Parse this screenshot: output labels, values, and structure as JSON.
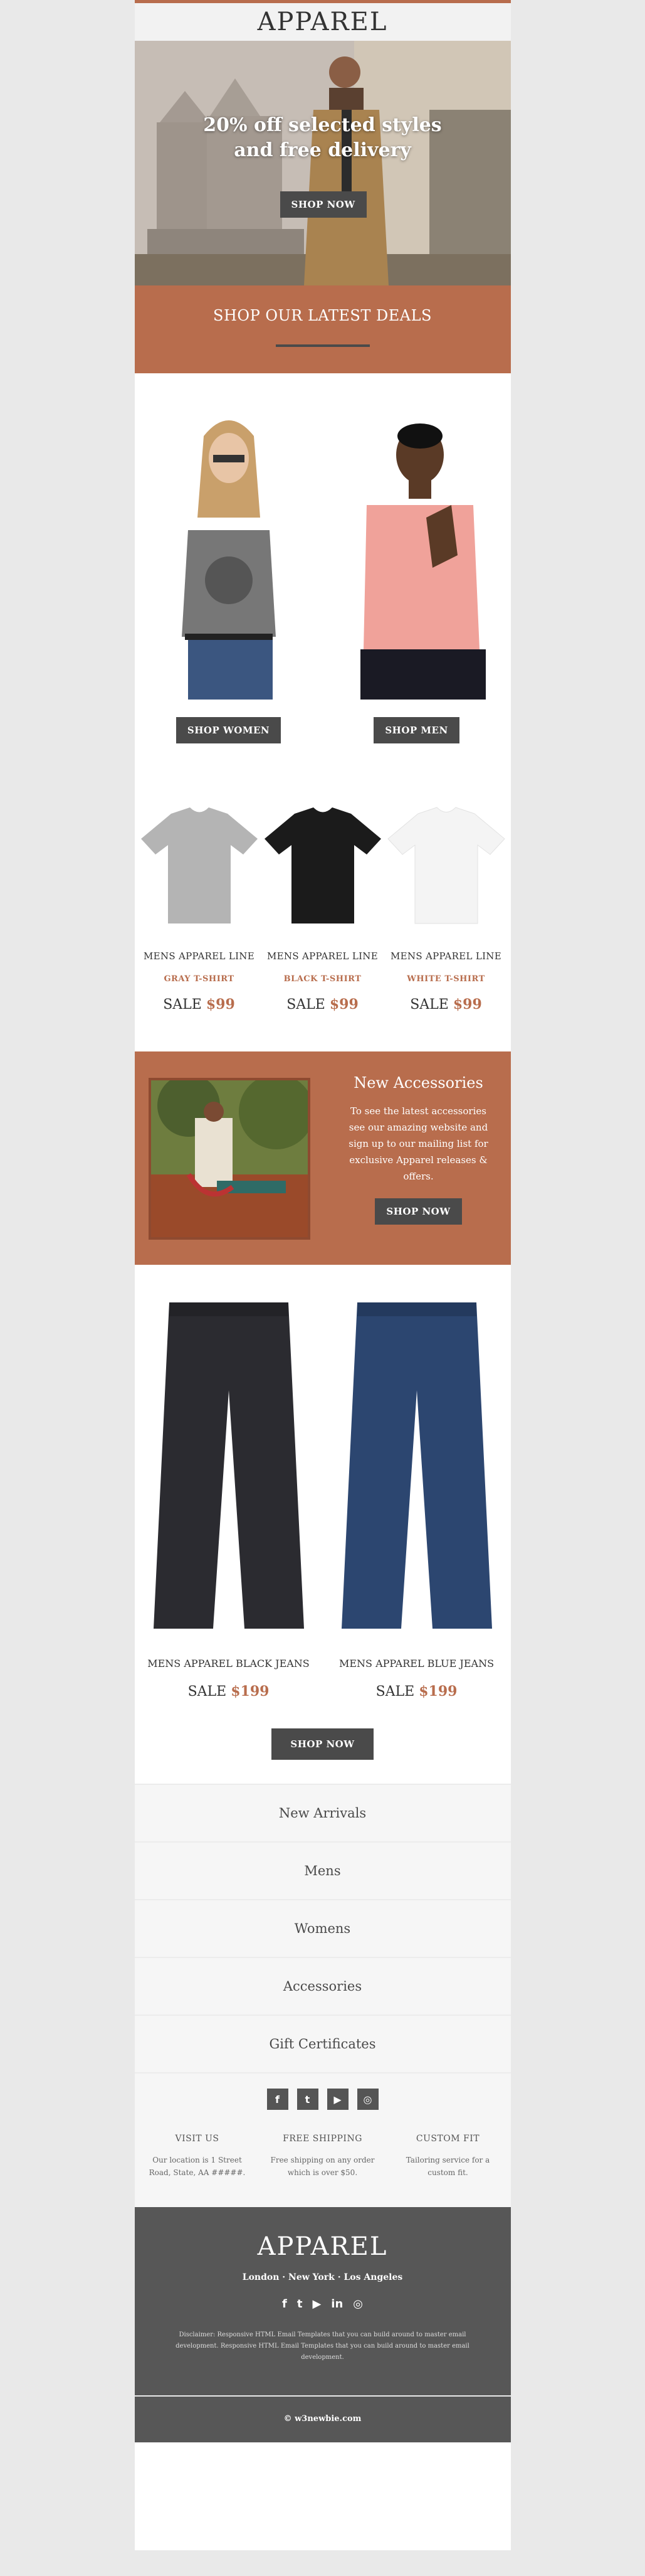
{
  "header": {
    "logo": "APPAREL"
  },
  "hero": {
    "headline_line1": "20% off selected styles",
    "headline_line2": "and free delivery",
    "button": "SHOP NOW"
  },
  "deals": {
    "title": "SHOP OUR LATEST DEALS"
  },
  "featured": [
    {
      "button": "SHOP WOMEN"
    },
    {
      "button": "SHOP MEN"
    }
  ],
  "tees": [
    {
      "name": "MENS APPAREL LINE",
      "color": "GRAY T-SHIRT",
      "sale": "SALE",
      "price": "$99",
      "swatch": "#b4b4b4"
    },
    {
      "name": "MENS APPAREL LINE",
      "color": "BLACK T-SHIRT",
      "sale": "SALE",
      "price": "$99",
      "swatch": "#1b1b1b"
    },
    {
      "name": "MENS APPAREL LINE",
      "color": "WHITE T-SHIRT",
      "sale": "SALE",
      "price": "$99",
      "swatch": "#f4f4f4"
    }
  ],
  "accessories": {
    "title": "New Accessories",
    "description": "To see the latest accessories see our amazing website and sign up to our mailing list for exclusive Apparel releases & offers.",
    "button": "SHOP NOW"
  },
  "jeans": [
    {
      "name": "MENS APPAREL BLACK JEANS",
      "sale": "SALE",
      "price": "$199",
      "swatch": "#2b2b30"
    },
    {
      "name": "MENS APPAREL BLUE JEANS",
      "sale": "SALE",
      "price": "$199",
      "swatch": "#2c4670"
    }
  ],
  "jeans_button": "SHOP NOW",
  "menu": [
    "New Arrivals",
    "Mens",
    "Womens",
    "Accessories",
    "Gift Certificates"
  ],
  "social_icons": [
    "facebook-icon",
    "twitter-icon",
    "youtube-icon",
    "instagram-icon"
  ],
  "info": [
    {
      "heading": "VISIT US",
      "body": "Our location is 1 Street Road, State, AA #####."
    },
    {
      "heading": "FREE SHIPPING",
      "body": "Free shipping on any order which is over $50."
    },
    {
      "heading": "CUSTOM FIT",
      "body": "Tailoring service for a custom fit."
    }
  ],
  "footer": {
    "logo": "APPAREL",
    "cities": "London · New York · Los Angeles",
    "disclaimer": "Disclaimer: Responsive HTML Email Templates that you can build around to master email development. Responsive HTML Email Templates that you can build around to master email development.",
    "copyright": "© w3newbie.com"
  },
  "colors": {
    "accent": "#b86d4d",
    "button": "#4a4a4a",
    "footer": "#575757"
  }
}
